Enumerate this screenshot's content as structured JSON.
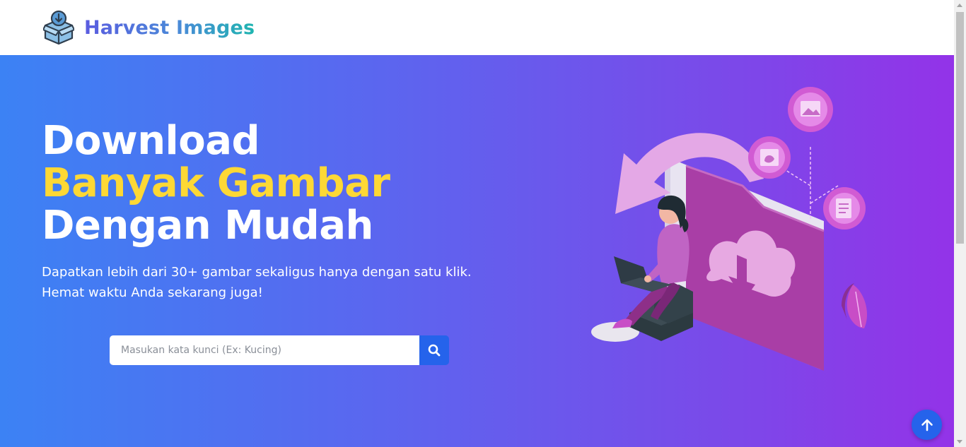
{
  "brand": {
    "name": "Harvest Images",
    "icon": "box-download-icon"
  },
  "hero": {
    "headline_line1": "Download",
    "headline_line2": "Banyak Gambar",
    "headline_line3": "Dengan Mudah",
    "subtext": "Dapatkan lebih dari 30+ gambar sekaligus hanya dengan satu klik. Hemat waktu Anda sekarang juga!",
    "illustration": "woman-laptop-cloud-download-illustration"
  },
  "search": {
    "placeholder": "Masukan kata kunci (Ex: Kucing)",
    "value": "",
    "button_icon": "search-icon"
  },
  "back_to_top": {
    "icon": "arrow-up-icon"
  },
  "colors": {
    "accent_yellow": "#fdd835",
    "primary_blue": "#2563eb",
    "gradient_start": "#3c82f4",
    "gradient_end": "#9333e8"
  }
}
